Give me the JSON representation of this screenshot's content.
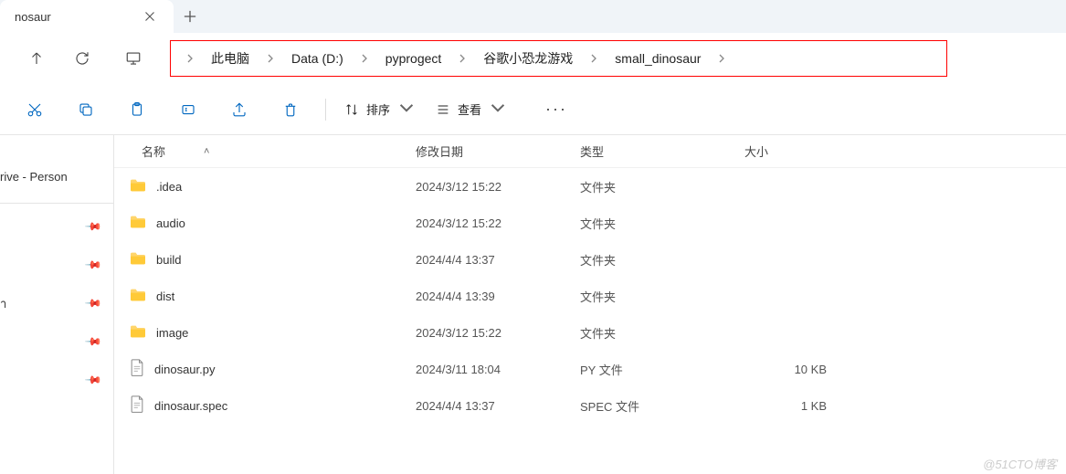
{
  "tab": {
    "title": "nosaur"
  },
  "breadcrumb": [
    {
      "label": "此电脑"
    },
    {
      "label": "Data (D:)"
    },
    {
      "label": "pyprogect"
    },
    {
      "label": "谷歌小恐龙游戏"
    },
    {
      "label": "small_dinosaur"
    }
  ],
  "toolbar": {
    "sort": "排序",
    "view": "查看"
  },
  "sidebar": {
    "drive_label": "rive - Person"
  },
  "columns": {
    "name": "名称",
    "date": "修改日期",
    "type": "类型",
    "size": "大小"
  },
  "files": [
    {
      "name": ".idea",
      "date": "2024/3/12 15:22",
      "type": "文件夹",
      "size": "",
      "icon": "folder"
    },
    {
      "name": "audio",
      "date": "2024/3/12 15:22",
      "type": "文件夹",
      "size": "",
      "icon": "folder"
    },
    {
      "name": "build",
      "date": "2024/4/4 13:37",
      "type": "文件夹",
      "size": "",
      "icon": "folder"
    },
    {
      "name": "dist",
      "date": "2024/4/4 13:39",
      "type": "文件夹",
      "size": "",
      "icon": "folder"
    },
    {
      "name": "image",
      "date": "2024/3/12 15:22",
      "type": "文件夹",
      "size": "",
      "icon": "folder"
    },
    {
      "name": "dinosaur.py",
      "date": "2024/3/11 18:04",
      "type": "PY 文件",
      "size": "10 KB",
      "icon": "file"
    },
    {
      "name": "dinosaur.spec",
      "date": "2024/4/4 13:37",
      "type": "SPEC 文件",
      "size": "1 KB",
      "icon": "file"
    }
  ],
  "watermark": "@51CTO博客"
}
